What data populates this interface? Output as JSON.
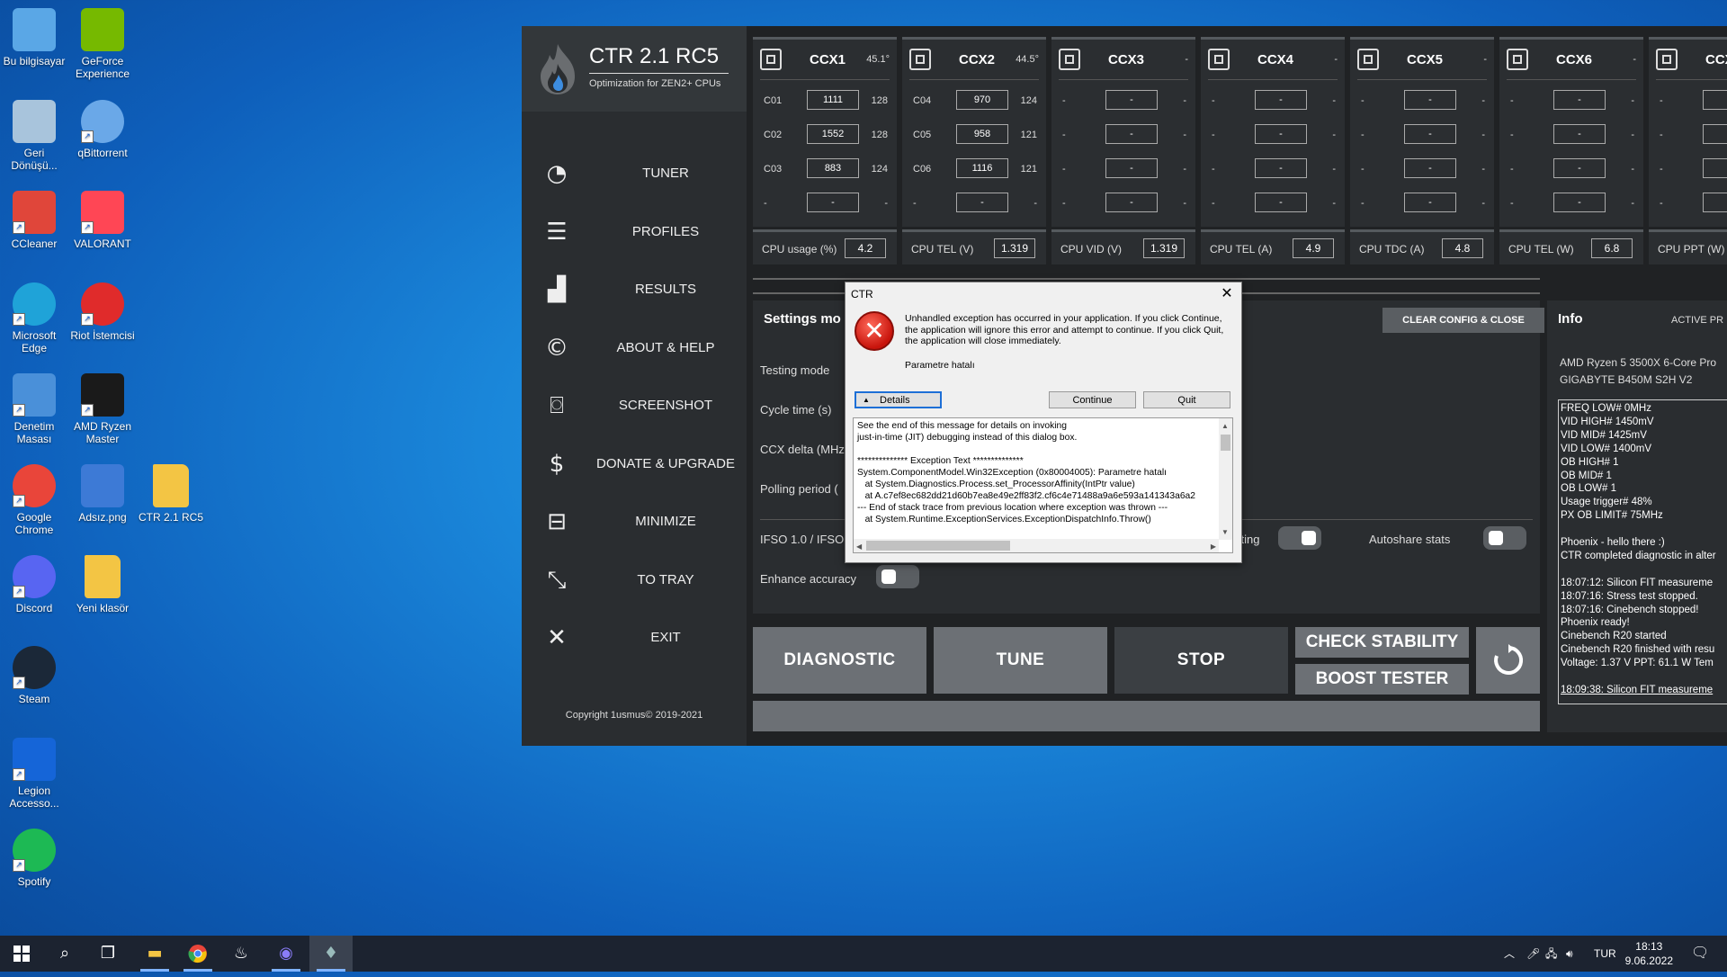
{
  "desktop": {
    "icons": [
      {
        "label": "Bu bilgisayar",
        "icon": "computer-icon",
        "color": "#5aa7e6"
      },
      {
        "label": "GeForce Experience",
        "icon": "nvidia-icon",
        "color": "#76b900"
      },
      {
        "label": "Geri Dönüşü...",
        "icon": "recycle-bin-icon",
        "color": "#a8c4dc"
      },
      {
        "label": "qBittorrent",
        "icon": "qbittorrent-icon",
        "color": "#6aa8e8"
      },
      {
        "label": "CCleaner",
        "icon": "ccleaner-icon",
        "color": "#e0463a"
      },
      {
        "label": "VALORANT",
        "icon": "valorant-icon",
        "color": "#ff4655"
      },
      {
        "label": "Microsoft Edge",
        "icon": "edge-icon",
        "color": "#1fa3d8"
      },
      {
        "label": "Riot İstemcisi",
        "icon": "riot-icon",
        "color": "#e02b2b"
      },
      {
        "label": "Denetim Masası",
        "icon": "control-panel-icon",
        "color": "#4a90d9"
      },
      {
        "label": "AMD Ryzen Master",
        "icon": "ryzen-icon",
        "color": "#1a1a1a"
      },
      {
        "label": "Google Chrome",
        "icon": "chrome-icon",
        "color": "#e9453a"
      },
      {
        "label": "Adsız.png",
        "icon": "image-file-icon",
        "color": "#3d7ad6"
      },
      {
        "label": "CTR 2.1 RC5",
        "icon": "folder-icon",
        "color": "#f3c544"
      },
      {
        "label": "Discord",
        "icon": "discord-icon",
        "color": "#5865f2"
      },
      {
        "label": "Yeni klasör",
        "icon": "folder-icon",
        "color": "#f3c544"
      },
      {
        "label": "Steam",
        "icon": "steam-icon",
        "color": "#1b2838"
      },
      {
        "label": "Legion Accesso...",
        "icon": "legion-icon",
        "color": "#1565d8"
      },
      {
        "label": "Spotify",
        "icon": "spotify-icon",
        "color": "#1db954"
      }
    ]
  },
  "ctr": {
    "title": "CTR 2.1 RC5",
    "subtitle": "Optimization for ZEN2+ CPUs",
    "nav": [
      {
        "label": "TUNER",
        "icon": "speedometer-icon"
      },
      {
        "label": "PROFILES",
        "icon": "list-icon"
      },
      {
        "label": "RESULTS",
        "icon": "bar-chart-icon"
      },
      {
        "label": "ABOUT & HELP",
        "icon": "copyright-icon"
      },
      {
        "label": "SCREENSHOT",
        "icon": "camera-icon"
      },
      {
        "label": "DONATE & UPGRADE",
        "icon": "donate-icon"
      },
      {
        "label": "MINIMIZE",
        "icon": "minimize-icon"
      },
      {
        "label": "TO TRAY",
        "icon": "tray-icon"
      },
      {
        "label": "EXIT",
        "icon": "close-icon"
      }
    ],
    "copyright": "Copyright 1usmus© 2019-2021",
    "ccx": [
      {
        "name": "CCX1",
        "temp": "45.1°",
        "rows": [
          [
            "C01",
            "1111",
            "128"
          ],
          [
            "C02",
            "1552",
            "128"
          ],
          [
            "C03",
            "883",
            "124"
          ],
          [
            "-",
            "-",
            "-"
          ]
        ]
      },
      {
        "name": "CCX2",
        "temp": "44.5°",
        "rows": [
          [
            "C04",
            "970",
            "124"
          ],
          [
            "C05",
            "958",
            "121"
          ],
          [
            "C06",
            "1116",
            "121"
          ],
          [
            "-",
            "-",
            "-"
          ]
        ]
      },
      {
        "name": "CCX3",
        "temp": "-",
        "rows": [
          [
            "-",
            "-",
            "-"
          ],
          [
            "-",
            "-",
            "-"
          ],
          [
            "-",
            "-",
            "-"
          ],
          [
            "-",
            "-",
            "-"
          ]
        ]
      },
      {
        "name": "CCX4",
        "temp": "-",
        "rows": [
          [
            "-",
            "-",
            "-"
          ],
          [
            "-",
            "-",
            "-"
          ],
          [
            "-",
            "-",
            "-"
          ],
          [
            "-",
            "-",
            "-"
          ]
        ]
      },
      {
        "name": "CCX5",
        "temp": "-",
        "rows": [
          [
            "-",
            "-",
            "-"
          ],
          [
            "-",
            "-",
            "-"
          ],
          [
            "-",
            "-",
            "-"
          ],
          [
            "-",
            "-",
            "-"
          ]
        ]
      },
      {
        "name": "CCX6",
        "temp": "-",
        "rows": [
          [
            "-",
            "-",
            "-"
          ],
          [
            "-",
            "-",
            "-"
          ],
          [
            "-",
            "-",
            "-"
          ],
          [
            "-",
            "-",
            "-"
          ]
        ]
      },
      {
        "name": "CCX",
        "temp": "",
        "rows": [
          [
            "-",
            "-",
            ""
          ],
          [
            "-",
            "-",
            ""
          ],
          [
            "-",
            "-",
            ""
          ],
          [
            "-",
            "-",
            ""
          ]
        ]
      }
    ],
    "stats": [
      {
        "label": "CPU usage (%)",
        "value": "4.2"
      },
      {
        "label": "CPU TEL (V)",
        "value": "1.319"
      },
      {
        "label": "CPU VID (V)",
        "value": "1.319"
      },
      {
        "label": "CPU TEL (A)",
        "value": "4.9"
      },
      {
        "label": "CPU TDC (A)",
        "value": "4.8"
      },
      {
        "label": "CPU TEL (W)",
        "value": "6.8"
      },
      {
        "label": "CPU PPT (W)",
        "value": ""
      }
    ],
    "settings": {
      "title": "Settings mo",
      "clear_button": "CLEAR CONFIG & CLOSE",
      "rows": [
        "Testing mode",
        "Cycle time (s)",
        "CCX delta (MHz)",
        "Polling period (",
        "IFSO 1.0 / IFSO 2",
        "Enhance accuracy"
      ],
      "sting_label": "sting",
      "autoshare_label": "Autoshare stats"
    },
    "buttons": {
      "diagnostic": "DIAGNOSTIC",
      "tune": "TUNE",
      "stop": "STOP",
      "check_stability": "CHECK STABILITY",
      "boost_tester": "BOOST TESTER"
    },
    "info": {
      "title": "Info",
      "active": "ACTIVE PR",
      "cpu": "AMD Ryzen 5 3500X 6-Core Pro",
      "board": "GIGABYTE B450M S2H V2",
      "log": [
        "FREQ LOW# 0MHz",
        "VID HIGH# 1450mV",
        "VID MID# 1425mV",
        "VID LOW# 1400mV",
        "OB HIGH# 1",
        "OB MID# 1",
        "OB LOW# 1",
        "Usage trigger# 48%",
        "PX OB LIMIT# 75MHz",
        "",
        "Phoenix - hello there :)",
        "CTR completed diagnostic in alter",
        "",
        "18:07:12: Silicon FIT measureme",
        "18:07:16: Stress test stopped.",
        "18:07:16: Cinebench stopped!",
        "Phoenix ready!",
        "Cinebench R20 started",
        "Cinebench R20 finished with resu",
        "Voltage: 1.37 V  PPT: 61.1 W  Tem",
        "",
        "18:09:38: Silicon FIT measureme"
      ]
    }
  },
  "dialog": {
    "title": "CTR",
    "message": "Unhandled exception has occurred in your application. If you click Continue, the application will ignore this error and attempt to continue. If you click Quit, the application will close immediately.",
    "param": "Parametre hatalı",
    "details_button": "Details",
    "continue_button": "Continue",
    "quit_button": "Quit",
    "details_text": "See the end of this message for details on invoking\njust-in-time (JIT) debugging instead of this dialog box.\n\n************** Exception Text **************\nSystem.ComponentModel.Win32Exception (0x80004005): Parametre hatalı\n   at System.Diagnostics.Process.set_ProcessorAffinity(IntPtr value)\n   at A.c7ef8ec682dd21d60b7ea8e49e2ff83f2.cf6c4e71488a9a6e593a141343a6a2\n--- End of stack trace from previous location where exception was thrown ---\n   at System.Runtime.ExceptionServices.ExceptionDispatchInfo.Throw()"
  },
  "taskbar": {
    "lang": "TUR",
    "time": "18:13",
    "date": "9.06.2022"
  }
}
